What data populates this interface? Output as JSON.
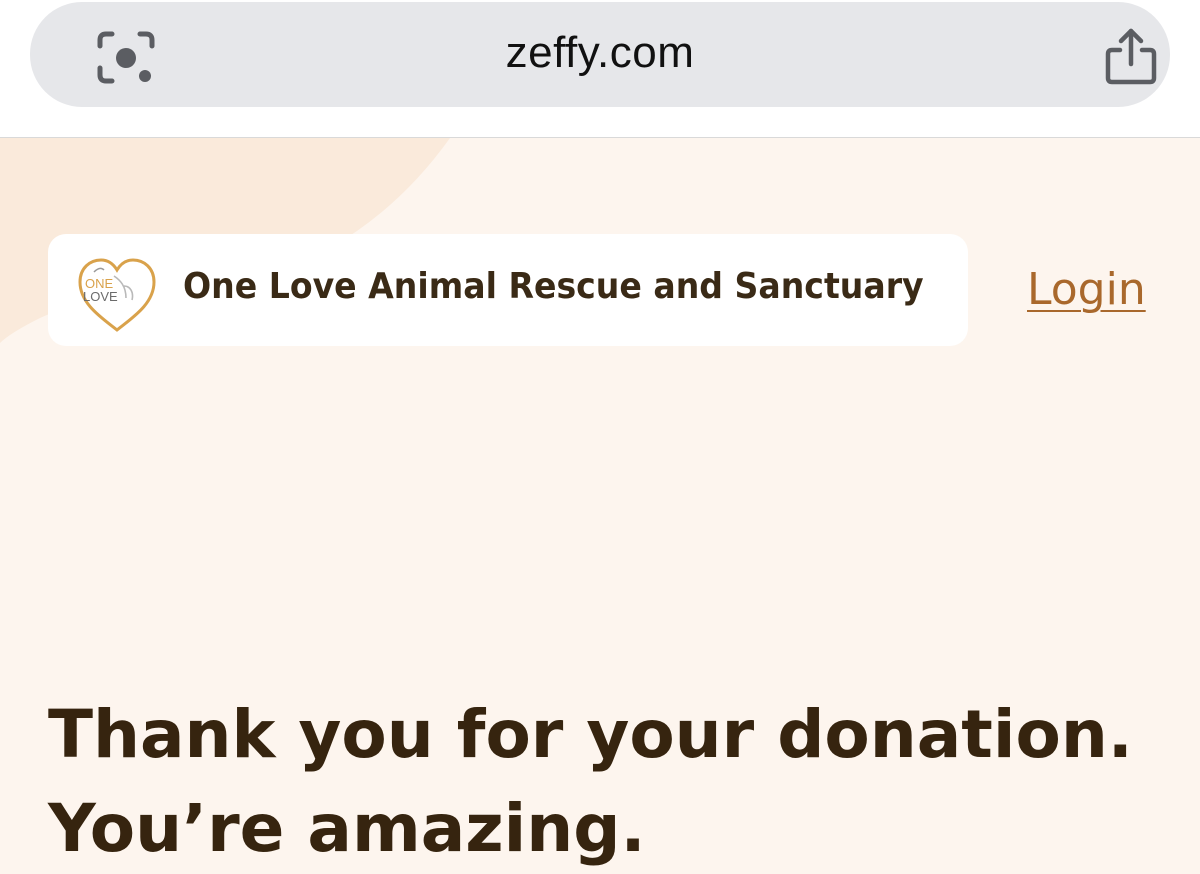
{
  "browser": {
    "url": "zeffy.com",
    "lens_icon": "camera-lens-icon",
    "share_icon": "share-icon"
  },
  "header": {
    "organization_name": "One Love Animal Rescue and Sanctuary",
    "logo_text": [
      "ONE",
      "LOVE"
    ],
    "login_label": "Login"
  },
  "main": {
    "heading_line1": "Thank you for your donation.",
    "heading_line2": "You’re amazing."
  },
  "colors": {
    "page_background": "#fdf5ee",
    "text_dark_brown": "#36240f",
    "link_brown": "#a9682c",
    "url_bar": "#e6e7ea"
  }
}
